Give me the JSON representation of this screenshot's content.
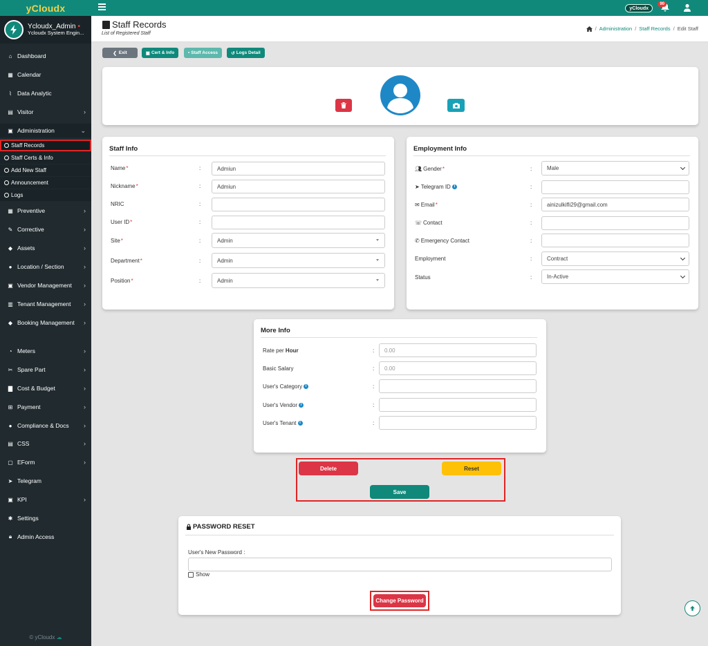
{
  "app": {
    "brand": "yCloudx",
    "top_brand": "yCloudx",
    "notification_count": "90",
    "footer": "© yCloudx"
  },
  "user": {
    "name": "Ycloudx_Admin",
    "role": "Ycloudx System Engin..."
  },
  "colors": {
    "primary": "#10897b",
    "sidebar": "#202a2f",
    "danger": "#dc3545",
    "warning": "#ffc107",
    "info": "#17a2b8",
    "highlight_outline": "#e02424"
  },
  "sidebar": {
    "items": [
      {
        "label": "Dashboard",
        "icon": "home-icon"
      },
      {
        "label": "Calendar",
        "icon": "calendar-icon"
      },
      {
        "label": "Data Analytic",
        "icon": "chart-line-icon"
      },
      {
        "label": "Visitor",
        "icon": "id-card-icon"
      },
      {
        "label": "Administration",
        "icon": "user-badge-icon"
      },
      {
        "label": "Preventive",
        "icon": "calendar-check-icon"
      },
      {
        "label": "Corrective",
        "icon": "wrench-icon"
      },
      {
        "label": "Assets",
        "icon": "tag-icon"
      },
      {
        "label": "Location / Section",
        "icon": "location-icon"
      },
      {
        "label": "Vendor Management",
        "icon": "vendor-icon"
      },
      {
        "label": "Tenant Management",
        "icon": "building-icon"
      },
      {
        "label": "Booking Management",
        "icon": "tag-icon"
      },
      {
        "label": "Meters",
        "icon": "gauge-icon"
      },
      {
        "label": "Spare Part",
        "icon": "tools-icon"
      },
      {
        "label": "Cost & Budget",
        "icon": "bar-chart-icon"
      },
      {
        "label": "Payment",
        "icon": "cart-icon"
      },
      {
        "label": "Compliance & Docs",
        "icon": "circle-icon"
      },
      {
        "label": "CSS",
        "icon": "file-icon"
      },
      {
        "label": "EForm",
        "icon": "form-icon"
      },
      {
        "label": "Telegram",
        "icon": "telegram-icon"
      },
      {
        "label": "KPI",
        "icon": "clipboard-icon"
      },
      {
        "label": "Settings",
        "icon": "gear-icon"
      },
      {
        "label": "Admin Access",
        "icon": "lock-icon"
      }
    ],
    "sub_items": [
      {
        "label": "Staff Records"
      },
      {
        "label": "Staff Certs & Info"
      },
      {
        "label": "Add New Staff"
      },
      {
        "label": "Announcement"
      },
      {
        "label": "Logs"
      }
    ]
  },
  "page": {
    "title": "Staff Records",
    "subtitle": "List of Registered Staff",
    "breadcrumb": [
      "Administration",
      "Staff Records",
      "Edit Staff"
    ]
  },
  "actions": {
    "exit": "Exit",
    "cert": "Cert & Info",
    "access": "Staff Access",
    "logs": "Logs Detail"
  },
  "staff_info": {
    "title": "Staff Info",
    "fields": [
      {
        "label": "Name",
        "required": "*",
        "value": "Admiun"
      },
      {
        "label": "Nickname",
        "required": "*",
        "value": "Admiun"
      },
      {
        "label": "NRIC",
        "required": "",
        "value": ""
      },
      {
        "label": "User ID",
        "required": "*",
        "value": ""
      },
      {
        "label": "Site",
        "required": "*",
        "value": "Admin"
      },
      {
        "label": "Department",
        "required": "*",
        "value": "Admin"
      },
      {
        "label": "Position",
        "required": "*",
        "value": "Admin"
      }
    ]
  },
  "employment_info": {
    "title": "Employment Info",
    "fields": [
      {
        "label": "Gender",
        "required": "*",
        "value": "Male",
        "icon": "users-icon"
      },
      {
        "label": "Telegram ID",
        "required": "",
        "value": "",
        "icon": "telegram-icon"
      },
      {
        "label": "Email",
        "required": "*",
        "value": "ainizulkifli29@gmail.com",
        "icon": "envelope-icon"
      },
      {
        "label": "Contact",
        "required": "",
        "value": "",
        "icon": "phone-square-icon"
      },
      {
        "label": "Emergency Contact",
        "required": "",
        "value": "",
        "icon": "phone-icon"
      },
      {
        "label": "Employment",
        "required": "",
        "value": "Contract"
      },
      {
        "label": "Status",
        "required": "",
        "value": "In-Active"
      }
    ]
  },
  "more_info": {
    "title": "More Info",
    "fields": [
      {
        "label": "Rate per",
        "label_bold": "Hour",
        "value": "0.00"
      },
      {
        "label": "Basic Salary",
        "value": "0.00"
      },
      {
        "label": "User's Category",
        "value": ""
      },
      {
        "label": "User's Vendor",
        "value": ""
      },
      {
        "label": "User's Tenant",
        "value": ""
      }
    ]
  },
  "buttons": {
    "delete": "Delete",
    "reset": "Reset",
    "save": "Save"
  },
  "password_reset": {
    "title": "PASSWORD RESET",
    "new_password_label": "User's New Password :",
    "show_label": "Show",
    "change_button": "Change Password"
  },
  "colon": ":"
}
